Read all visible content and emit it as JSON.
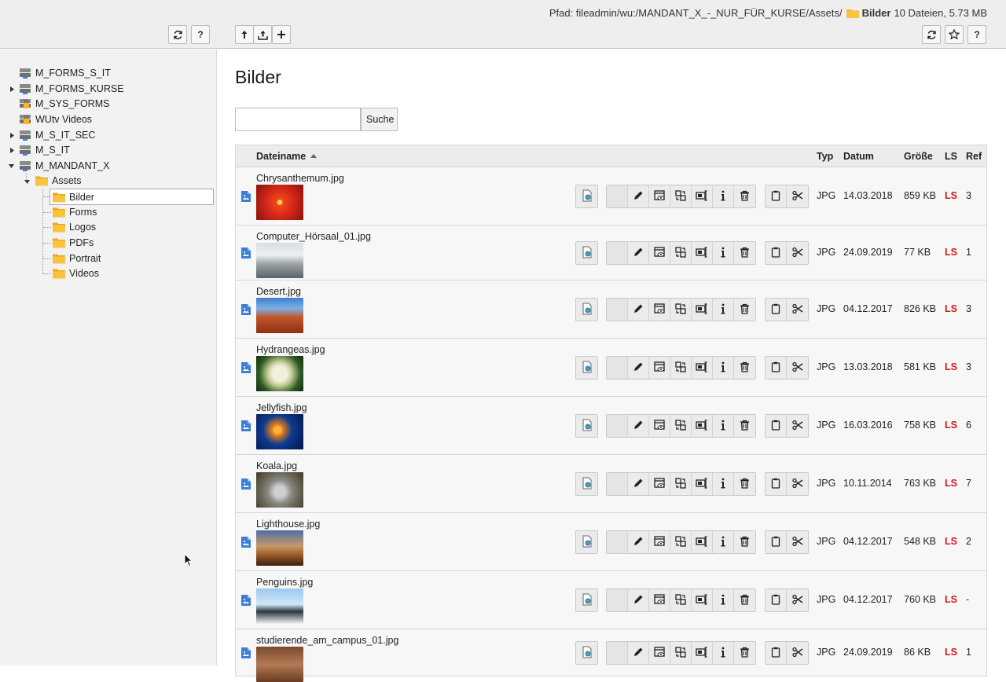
{
  "topbar": {
    "path_prefix": "Pfad: fileadmin/wu:/MANDANT_X_-_NUR_FÜR_KURSE/Assets/",
    "current_folder": "Bilder",
    "summary": "10 Dateien, 5.73 MB",
    "help_label": "?"
  },
  "tree": {
    "items": [
      {
        "label": "M_FORMS_S_IT",
        "icon": "storage-icon",
        "expandable": false
      },
      {
        "label": "M_FORMS_KURSE",
        "icon": "storage-icon",
        "expandable": true
      },
      {
        "label": "M_SYS_FORMS",
        "icon": "locked-storage-icon",
        "expandable": false
      },
      {
        "label": "WUtv Videos",
        "icon": "locked-storage-icon",
        "expandable": false
      },
      {
        "label": "M_S_IT_SEC",
        "icon": "storage-icon",
        "expandable": true
      },
      {
        "label": "M_S_IT",
        "icon": "storage-icon",
        "expandable": true
      },
      {
        "label": "M_MANDANT_X",
        "icon": "storage-icon",
        "expanded": true
      }
    ],
    "assets_label": "Assets",
    "folders": [
      "Bilder",
      "Forms",
      "Logos",
      "PDFs",
      "Portrait",
      "Videos"
    ],
    "selected": "Bilder"
  },
  "main": {
    "title": "Bilder",
    "search": {
      "value": "",
      "button_label": "Suche"
    },
    "columns": {
      "name": "Dateiname",
      "type": "Typ",
      "date": "Datum",
      "size": "Größe",
      "ls": "LS",
      "ref": "Ref"
    },
    "files": [
      {
        "name": "Chrysanthemum.jpg",
        "type": "JPG",
        "date": "14.03.2018",
        "size": "859 KB",
        "ls": "LS",
        "ref": "3"
      },
      {
        "name": "Computer_Hörsaal_01.jpg",
        "type": "JPG",
        "date": "24.09.2019",
        "size": "77 KB",
        "ls": "LS",
        "ref": "1"
      },
      {
        "name": "Desert.jpg",
        "type": "JPG",
        "date": "04.12.2017",
        "size": "826 KB",
        "ls": "LS",
        "ref": "3"
      },
      {
        "name": "Hydrangeas.jpg",
        "type": "JPG",
        "date": "13.03.2018",
        "size": "581 KB",
        "ls": "LS",
        "ref": "3"
      },
      {
        "name": "Jellyfish.jpg",
        "type": "JPG",
        "date": "16.03.2016",
        "size": "758 KB",
        "ls": "LS",
        "ref": "6"
      },
      {
        "name": "Koala.jpg",
        "type": "JPG",
        "date": "10.11.2014",
        "size": "763 KB",
        "ls": "LS",
        "ref": "7"
      },
      {
        "name": "Lighthouse.jpg",
        "type": "JPG",
        "date": "04.12.2017",
        "size": "548 KB",
        "ls": "LS",
        "ref": "2"
      },
      {
        "name": "Penguins.jpg",
        "type": "JPG",
        "date": "04.12.2017",
        "size": "760 KB",
        "ls": "LS",
        "ref": "-"
      },
      {
        "name": "studierende_am_campus_01.jpg",
        "type": "JPG",
        "date": "24.09.2019",
        "size": "86 KB",
        "ls": "LS",
        "ref": "1"
      }
    ],
    "row_actions": [
      "view-icon",
      "edit-icon",
      "preview-icon",
      "replace-icon",
      "rename-icon",
      "info-icon",
      "delete-icon",
      "copy-icon",
      "cut-icon"
    ]
  },
  "colors": {
    "ls_red": "#d21818",
    "folder_yellow": "#f6b924",
    "file_blue": "#3c7fd4",
    "topbar_bg": "#eeeeee",
    "sidebar_bg": "#f2f2f2"
  }
}
